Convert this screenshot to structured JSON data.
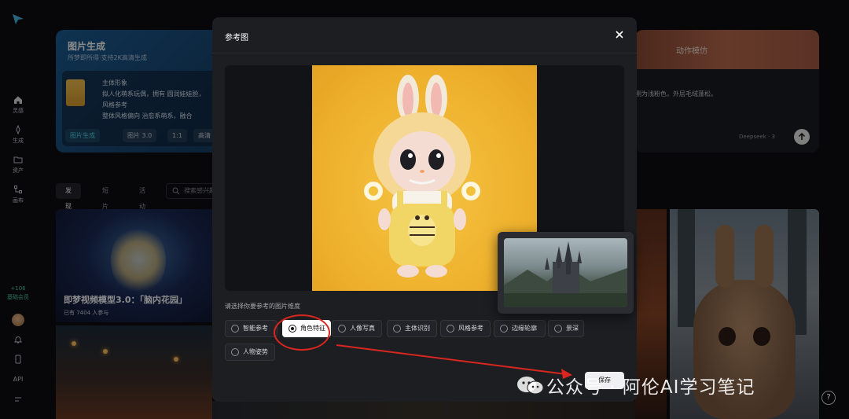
{
  "rail": {
    "items": [
      {
        "label": "灵感",
        "icon": "home-icon"
      },
      {
        "label": "生成",
        "icon": "sparkle-icon"
      },
      {
        "label": "资产",
        "icon": "folder-icon"
      },
      {
        "label": "画布",
        "icon": "canvas-icon"
      }
    ],
    "credit_value": "+106",
    "credit_label": "基础会员",
    "api_label": "API"
  },
  "card_left": {
    "title": "图片生成",
    "subtitle": "所梦即所得·支持2K高清生成",
    "line1": "主体形象",
    "line2": "拟人化萌系玩偶，拥有 圆润娃娃脸，",
    "line3": "风格参考",
    "line4": "整体风格偏向 治愈系萌系，融合",
    "chips": [
      "图片生成",
      "图片 3.0",
      "1:1",
      "高清 2"
    ]
  },
  "card_right": {
    "title": "动作模仿",
    "text": "侧为浅粉色，外层毛绒蓬松。",
    "model": "Deepseek",
    "count": "3"
  },
  "tabs": [
    "发现",
    "短片",
    "活动"
  ],
  "search_placeholder": "搜索感兴趣",
  "gallery": {
    "title": "即梦视频模型3.0：「脑内花园」",
    "subtitle": "已有 7404 人参与"
  },
  "modal": {
    "title": "参考图",
    "hint": "请选择你要参考的图片维度",
    "options": [
      "智能参考",
      "角色特征",
      "人像写真",
      "主体识别",
      "风格参考",
      "边缘轮廓",
      "景深",
      "人物姿势"
    ],
    "selected": "角色特征",
    "save_label": "保存"
  },
  "watermark": "公众号 · 阿伦AI学习笔记",
  "help_label": "?",
  "colors": {
    "accent": "#52d3e6",
    "annotation": "#d9261e",
    "modal_bg": "#1d1e22"
  }
}
